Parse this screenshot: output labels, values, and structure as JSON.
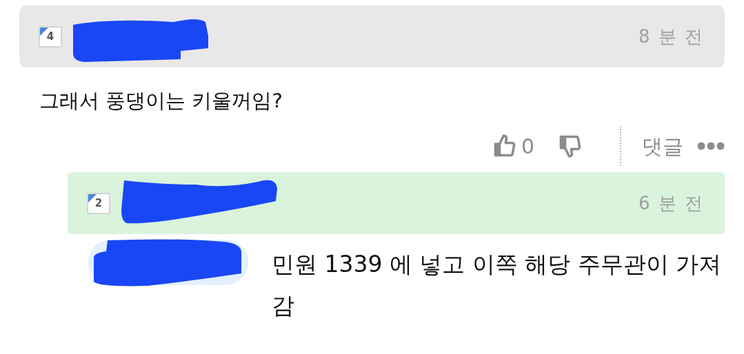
{
  "comment": {
    "badge": "4",
    "time": "8 분 전",
    "text": "그래서 풍댕이는 키울꺼임?",
    "likes": "0",
    "reply_label": "댓글"
  },
  "reply": {
    "badge": "2",
    "time": "6 분 전",
    "text": "민원 1339 에 넣고 이쪽 해당 주무관이 가져감"
  }
}
